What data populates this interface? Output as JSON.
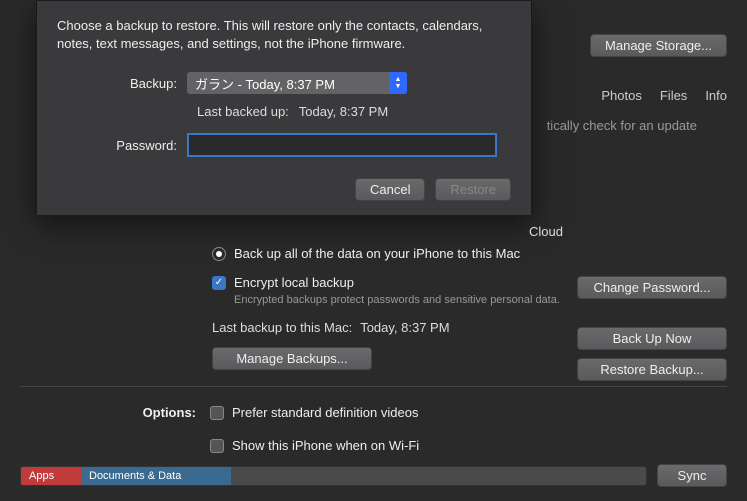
{
  "header": {
    "manage_storage": "Manage Storage...",
    "tabs": [
      "Photos",
      "Files",
      "Info"
    ],
    "bg_text": "tically check for an update"
  },
  "dialog": {
    "instruction": "Choose a backup to restore. This will restore only the contacts, calendars, notes, text messages, and settings, not the iPhone firmware.",
    "backup_label": "Backup:",
    "backup_selected": "ガラン - Today, 8:37 PM",
    "last_backed_up_label": "Last backed up:",
    "last_backed_up_value": "Today, 8:37 PM",
    "password_label": "Password:",
    "password_value": "",
    "cancel": "Cancel",
    "restore": "Restore"
  },
  "backup": {
    "cloud_text": "Cloud",
    "radio_local": "Back up all of the data on your iPhone to this Mac",
    "encrypt_label": "Encrypt local backup",
    "encrypt_sub": "Encrypted backups protect passwords and sensitive personal data.",
    "change_password": "Change Password...",
    "last_backup_label": "Last backup to this Mac:",
    "last_backup_value": "Today, 8:37 PM",
    "back_up_now": "Back Up Now",
    "manage_backups": "Manage Backups...",
    "restore_backup": "Restore Backup..."
  },
  "options": {
    "label": "Options:",
    "prefer_sd": "Prefer standard definition videos",
    "show_wifi": "Show this iPhone when on Wi-Fi"
  },
  "storage": {
    "apps": "Apps",
    "docs": "Documents & Data",
    "sync": "Sync"
  }
}
